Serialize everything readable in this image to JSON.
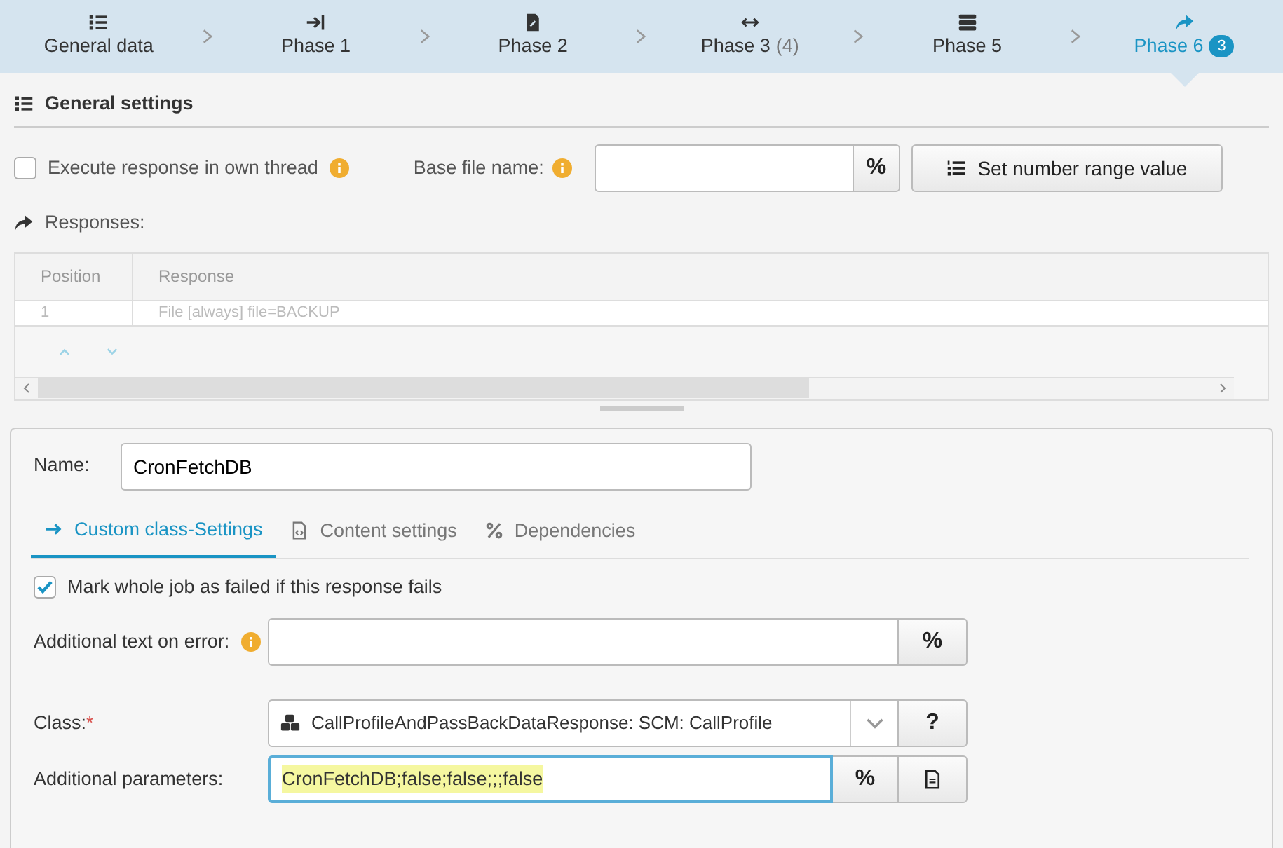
{
  "steps": [
    {
      "label": "General data",
      "kind": "list",
      "selected": false
    },
    {
      "label": "Phase 1",
      "kind": "start",
      "selected": false
    },
    {
      "label": "Phase 2",
      "kind": "edit",
      "selected": false
    },
    {
      "label": "Phase 3",
      "count": "(4)",
      "kind": "exchange",
      "selected": false
    },
    {
      "label": "Phase 5",
      "kind": "storage",
      "selected": false
    },
    {
      "label": "Phase 6",
      "badge": "3",
      "kind": "response",
      "selected": true
    }
  ],
  "general_settings": {
    "title": "General settings"
  },
  "execute_own_thread": {
    "label": "Execute response in own thread",
    "checked": false
  },
  "base_file_name": {
    "label": "Base file name:",
    "button": "%"
  },
  "set_number_range_button": "Set number range value",
  "responses": {
    "label": "Responses:",
    "columns": [
      "Position",
      "Response"
    ],
    "rows": [
      [
        "1",
        "File [always] file=BACKUP"
      ]
    ]
  },
  "name_field": {
    "label": "Name:",
    "value": "CronFetchDB"
  },
  "tabs": [
    {
      "label": "Custom class-Settings",
      "kind": "custom",
      "selected": true
    },
    {
      "label": "Content settings",
      "kind": "content",
      "selected": false
    },
    {
      "label": "Dependencies",
      "kind": "dependencies",
      "selected": false
    }
  ],
  "mark_failed": {
    "label": "Mark whole job as failed if this response fails",
    "checked": true
  },
  "additional_text": {
    "label": "Additional text on error:",
    "button": "%"
  },
  "class_field": {
    "label": "Class:",
    "required_mark": "*",
    "value": "CallProfileAndPassBackDataResponse: SCM: CallProfile",
    "help_button": "?"
  },
  "additional_parameters": {
    "label": "Additional parameters:",
    "value": "CronFetchDB;false;false;;;false",
    "button": "%"
  }
}
